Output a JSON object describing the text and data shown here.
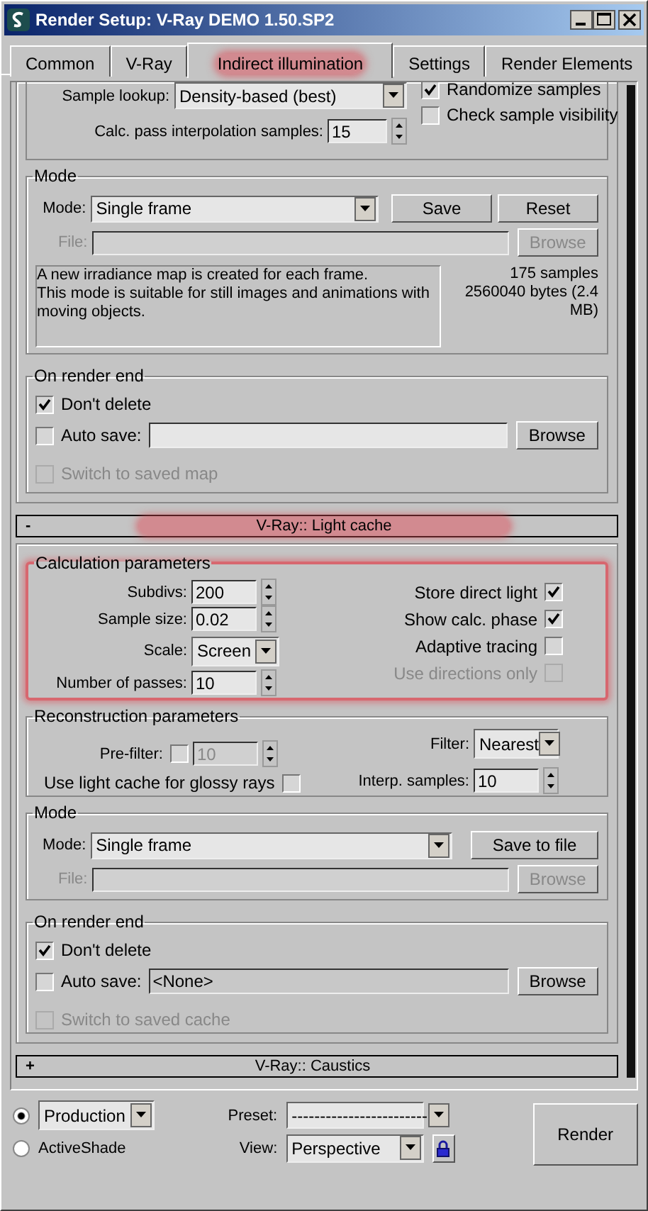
{
  "window": {
    "title": "Render Setup: V-Ray DEMO 1.50.SP2"
  },
  "tabs": [
    {
      "label": "Common",
      "selected": false,
      "highlighted": false
    },
    {
      "label": "V-Ray",
      "selected": false,
      "highlighted": false
    },
    {
      "label": "Indirect illumination",
      "selected": true,
      "highlighted": true
    },
    {
      "label": "Settings",
      "selected": false,
      "highlighted": false
    },
    {
      "label": "Render Elements",
      "selected": false,
      "highlighted": false
    }
  ],
  "irradiance_map": {
    "sample_lookup": {
      "label": "Sample lookup:",
      "value": "Density-based (best)"
    },
    "calc_pass": {
      "label": "Calc. pass interpolation samples:",
      "value": "15"
    },
    "options": [
      {
        "label": "Randomize samples",
        "checked": true
      },
      {
        "label": "Check sample visibility",
        "checked": false
      }
    ],
    "mode": {
      "title": "Mode",
      "mode_label": "Mode:",
      "mode_value": "Single frame",
      "buttons": [
        {
          "label": "Save",
          "disabled": false
        },
        {
          "label": "Reset",
          "disabled": false
        }
      ],
      "file_label": "File:",
      "file_disabled": true,
      "browse": {
        "label": "Browse",
        "disabled": true
      },
      "description": "A new irradiance map is created for each frame.\nThis mode is suitable for still images and animations with\nmoving objects.",
      "stats": [
        "175 samples",
        "2560040 bytes (2.4 MB)"
      ]
    },
    "on_render_end": {
      "title": "On render end",
      "dont_delete": {
        "label": "Don't delete",
        "checked": true
      },
      "auto_save": {
        "label": "Auto save:",
        "checked": false
      },
      "browse": {
        "label": "Browse",
        "disabled": false
      },
      "switch": {
        "label": "Switch to saved map",
        "checked": false,
        "disabled": true
      }
    }
  },
  "light_cache": {
    "toggle": "-",
    "title": "V-Ray:: Light cache",
    "highlighted": true,
    "calculation": {
      "title": "Calculation parameters",
      "highlighted": true,
      "fields": [
        {
          "kind": "spinner",
          "label": "Subdivs:",
          "value": "200"
        },
        {
          "kind": "spinner",
          "label": "Sample size:",
          "value": "0.02"
        },
        {
          "kind": "dropdown",
          "label": "Scale:",
          "value": "Screen"
        },
        {
          "kind": "spinner",
          "label": "Number of passes:",
          "value": "10"
        }
      ],
      "options": [
        {
          "label": "Store direct light",
          "checked": true,
          "disabled": false
        },
        {
          "label": "Show calc. phase",
          "checked": true,
          "disabled": false
        },
        {
          "label": "Adaptive tracing",
          "checked": false,
          "disabled": false
        },
        {
          "label": "Use directions only",
          "checked": false,
          "disabled": true
        }
      ]
    },
    "reconstruction": {
      "title": "Reconstruction parameters",
      "prefilter": {
        "label": "Pre-filter:",
        "checked": false,
        "value": "10",
        "disabled": true
      },
      "glossy": {
        "label": "Use light cache for glossy rays",
        "checked": false
      },
      "filter": {
        "label": "Filter:",
        "value": "Nearest"
      },
      "interp": {
        "label": "Interp. samples:",
        "value": "10"
      }
    },
    "mode": {
      "title": "Mode",
      "mode_label": "Mode:",
      "mode_value": "Single frame",
      "buttons": [
        {
          "label": "Save to file",
          "disabled": false
        }
      ],
      "file_label": "File:",
      "file_disabled": true,
      "browse": {
        "label": "Browse",
        "disabled": true
      }
    },
    "on_render_end": {
      "title": "On render end",
      "dont_delete": {
        "label": "Don't delete",
        "checked": true
      },
      "auto_save": {
        "label": "Auto save:",
        "checked": false,
        "value": "<None>"
      },
      "browse": {
        "label": "Browse",
        "disabled": false
      },
      "switch": {
        "label": "Switch to saved cache",
        "checked": false,
        "disabled": true
      }
    }
  },
  "caustics": {
    "toggle": "+",
    "title": "V-Ray:: Caustics",
    "highlighted": false
  },
  "footer": {
    "render_modes": [
      {
        "kind": "dropdown",
        "label": "Production",
        "selected": true
      },
      {
        "kind": "text",
        "label": "ActiveShade",
        "selected": false
      }
    ],
    "preset": {
      "label": "Preset:",
      "value": "------------------------"
    },
    "view": {
      "label": "View:",
      "value": "Perspective"
    },
    "render_button": "Render"
  }
}
